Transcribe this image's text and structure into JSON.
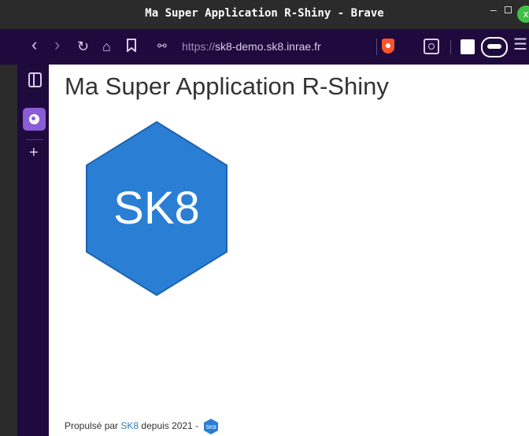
{
  "window": {
    "title": "Ma Super Application R-Shiny - Brave",
    "close_label": "x"
  },
  "toolbar": {
    "url_scheme": "https://",
    "url_host": "sk8-demo.sk8.inrae.fr"
  },
  "page": {
    "heading": "Ma Super Application R-Shiny",
    "logo_text": "SK8",
    "footer": {
      "prefix": "Propulsé par",
      "link_text": "SK8",
      "suffix": "depuis 2021 -",
      "mini_logo_text": "SK8"
    }
  },
  "colors": {
    "logo_fill": "#2a7fd4",
    "link": "#337ab7",
    "browser_chrome": "#1f0a3d",
    "close_button": "#3fbf46"
  }
}
